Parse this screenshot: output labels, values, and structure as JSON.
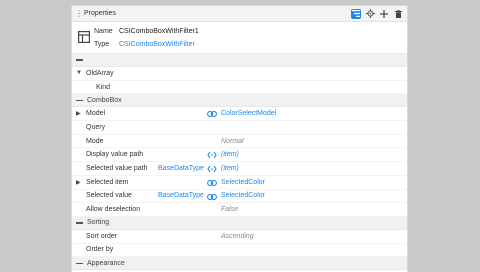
{
  "panel": {
    "title": "Properties",
    "toolbar": {
      "filter_icon": "list-filter-icon",
      "settings_icon": "gear-icon",
      "add_icon": "plus-icon",
      "delete_icon": "trash-icon"
    }
  },
  "header": {
    "name_label": "Name",
    "name_value": "CSIComboBoxWithFilter1",
    "type_label": "Type",
    "type_value": "CSIComboBoxWithFilter"
  },
  "sections": {
    "unnamed": "",
    "oldarray": "OldArray",
    "combobox": "ComboBox",
    "sorting": "Sorting",
    "appearance": "Appearance"
  },
  "rows": {
    "kind": {
      "name": "Kind",
      "value": ""
    },
    "model": {
      "name": "Model",
      "value": "ColorSelectModel"
    },
    "query": {
      "name": "Query",
      "value": ""
    },
    "mode": {
      "name": "Mode",
      "value": "Normal"
    },
    "display_value_path": {
      "name": "Display value path",
      "value": "(item)"
    },
    "selected_value_path": {
      "name": "Selected value path",
      "type": "BaseDataType",
      "value": "(item)"
    },
    "selected_item": {
      "name": "Selected item",
      "value": "SelectedColor"
    },
    "selected_value": {
      "name": "Selected value",
      "type": "BaseDataType",
      "value": "SelectedColor"
    },
    "allow_deselection": {
      "name": "Allow deselection",
      "value": "False"
    },
    "sort_order": {
      "name": "Sort order",
      "value": "Ascending"
    },
    "order_by": {
      "name": "Order by",
      "value": ""
    }
  },
  "colors": {
    "accent": "#1e88e5",
    "background": "#c9c9c9",
    "section_bg": "#f1f1f1"
  }
}
